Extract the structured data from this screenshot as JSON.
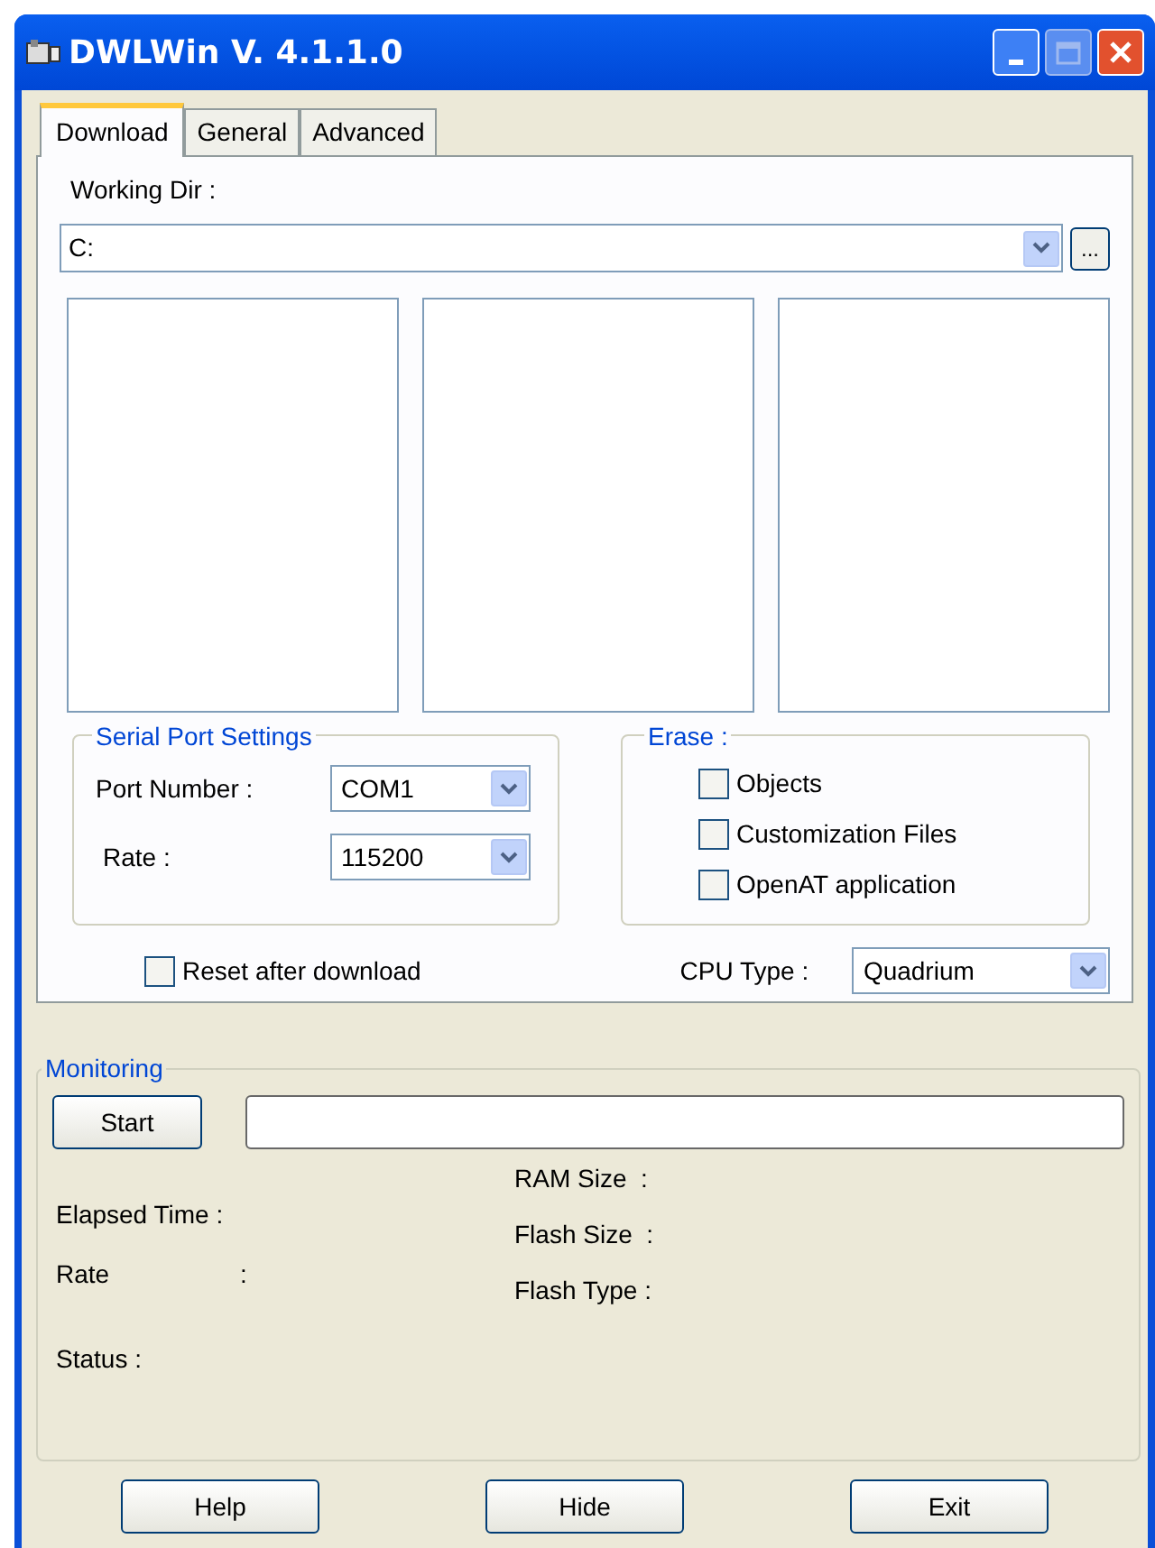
{
  "window": {
    "title": "DWLWin V. 4.1.1.0"
  },
  "tabs": [
    {
      "label": "Download",
      "selected": true
    },
    {
      "label": "General",
      "selected": false
    },
    {
      "label": "Advanced",
      "selected": false
    }
  ],
  "working_dir": {
    "label": "Working Dir :",
    "value": "C:",
    "browse": "..."
  },
  "serial_port": {
    "title": "Serial Port Settings",
    "fields": [
      {
        "label": "Port Number :",
        "value": "COM1"
      },
      {
        "label": "Rate :",
        "value": "115200"
      }
    ]
  },
  "erase": {
    "title": "Erase :",
    "options": [
      {
        "label": "Objects",
        "checked": false
      },
      {
        "label": "Customization Files",
        "checked": false
      },
      {
        "label": "OpenAT application",
        "checked": false
      }
    ]
  },
  "reset_after_download": {
    "label": "Reset after download",
    "checked": false
  },
  "cpu_type": {
    "label": "CPU Type :",
    "value": "Quadrium"
  },
  "monitoring": {
    "title": "Monitoring",
    "start": "Start",
    "left": [
      {
        "label": "Elapsed Time :"
      },
      {
        "label": "Rate",
        "colon": ":"
      }
    ],
    "right": [
      "RAM Size  :",
      "Flash Size  :",
      "Flash Type :"
    ],
    "status": "Status :"
  },
  "buttons": [
    "Help",
    "Hide",
    "Exit"
  ]
}
